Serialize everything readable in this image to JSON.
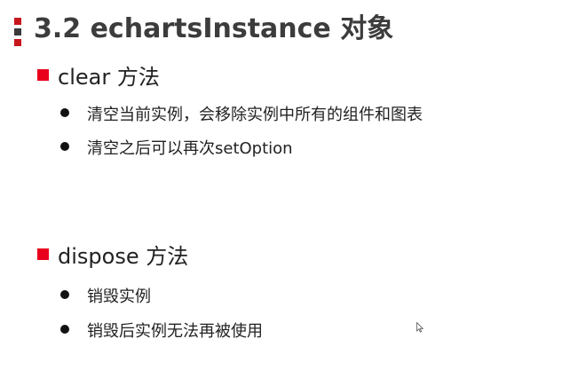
{
  "header": {
    "title": "3.2 echartsInstance 对象"
  },
  "sections": [
    {
      "heading": "clear 方法",
      "bullets": [
        "清空当前实例，会移除实例中所有的组件和图表",
        "清空之后可以再次setOption"
      ]
    },
    {
      "heading": "dispose 方法",
      "bullets": [
        "销毁实例",
        "销毁后实例无法再被使用"
      ]
    }
  ],
  "colors": {
    "accent_red": "#e8001c",
    "deco_red": "#c8161d",
    "deco_dark": "#3a3a3a",
    "title_text": "#3c3c3c"
  },
  "icons": {
    "header_decoration": "three-square-stack",
    "section_marker": "red-square",
    "bullet_marker": "black-dot",
    "pointer": "mouse-cursor-icon"
  }
}
